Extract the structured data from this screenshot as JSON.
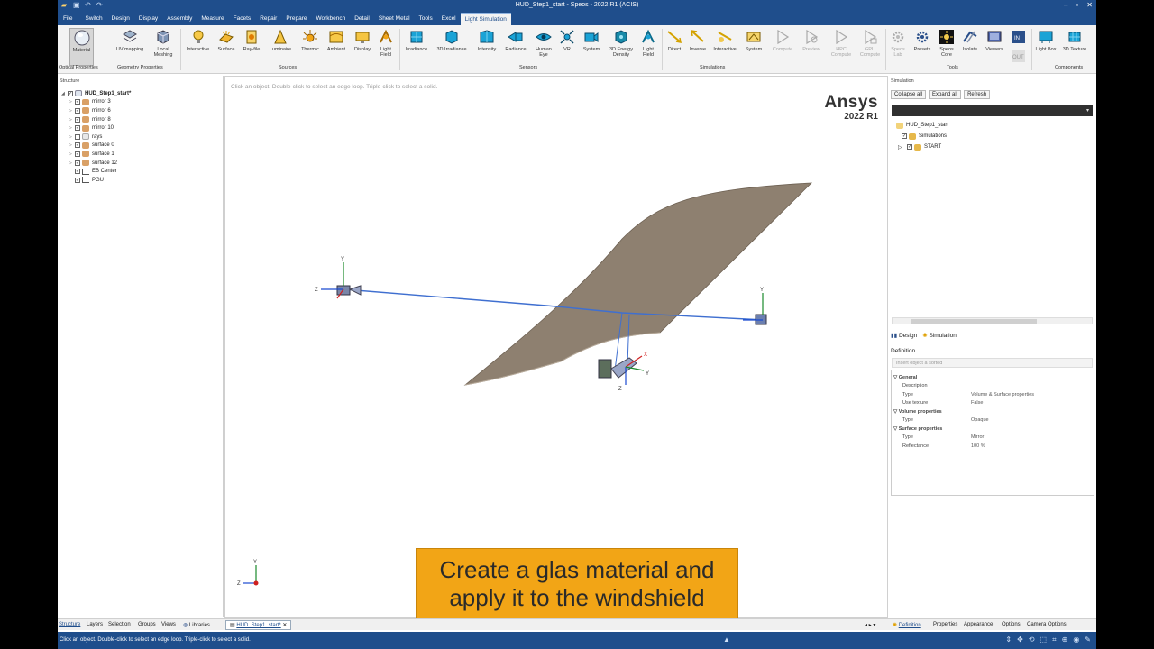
{
  "window": {
    "title": "HUD_Step1_start - Speos - 2022 R1 (ACIS)",
    "controls": [
      "–",
      "▫",
      "✕"
    ]
  },
  "menu_tabs": [
    "File",
    "Switch",
    "Design",
    "Display",
    "Assembly",
    "Measure",
    "Facets",
    "Repair",
    "Prepare",
    "Workbench",
    "Detail",
    "Sheet Metal",
    "Tools",
    "Excel",
    "Light Simulation"
  ],
  "active_tab": "Light Simulation",
  "ribbon": {
    "optical": {
      "group": "Optical Properties",
      "buttons": [
        "Material"
      ]
    },
    "geometry": {
      "group": "Geometry Properties",
      "buttons": [
        "UV mapping",
        "Local Meshing"
      ]
    },
    "sources": {
      "group": "Sources",
      "buttons": [
        "Interactive",
        "Surface",
        "Ray-file",
        "Luminaire",
        "Thermic",
        "Ambient",
        "Display",
        "Light Field"
      ]
    },
    "sensors": {
      "group": "Sensors",
      "buttons": [
        "Irradiance",
        "3D Irradiance",
        "Intensity",
        "Radiance",
        "Human Eye",
        "VR",
        "System",
        "3D Energy Density",
        "Light Field"
      ]
    },
    "simulations": {
      "group": "Simulations",
      "buttons": [
        "Direct",
        "Inverse",
        "Interactive",
        "System",
        "Compute",
        "Preview",
        "HPC Compute",
        "GPU Compute"
      ]
    },
    "tools": {
      "group": "Tools",
      "buttons": [
        "Speos Lab",
        "Presets",
        "Speos Core",
        "Isolate",
        "Viewers",
        "IN",
        "OUT"
      ]
    },
    "components": {
      "group": "Components",
      "buttons": [
        "Light Box",
        "3D Texture"
      ]
    }
  },
  "structure": {
    "header": "Structure",
    "root": "HUD_Step1_start*",
    "items": [
      "mirror 3",
      "mirror 6",
      "mirror 8",
      "mirror 10",
      "rays",
      "surface 0",
      "surface 1",
      "surface 12",
      "EB Center",
      "PGU"
    ]
  },
  "viewport": {
    "hint": "Click an object. Double-click to select an edge loop. Triple-click to select a solid.",
    "brand_name": "Ansys",
    "brand_version": "2022 R1",
    "axis_labels": {
      "x": "X",
      "y": "Y",
      "z": "Z"
    },
    "caption_line1": "Create a glas material and",
    "caption_line2": "apply it to the windshield"
  },
  "simulation_panel": {
    "header": "Simulation",
    "buttons": [
      "Collapse all",
      "Expand all",
      "Refresh"
    ],
    "tree": [
      "HUD_Step1_start",
      "Simulations",
      "START"
    ],
    "tabs": [
      "Design",
      "Simulation"
    ]
  },
  "definition": {
    "header": "Definition",
    "placeholder": "Insert object a sorted",
    "sections": [
      {
        "title": "General",
        "rows": [
          [
            "Description",
            ""
          ],
          [
            "Type",
            "Volume & Surface properties"
          ],
          [
            "Use texture",
            "False"
          ]
        ]
      },
      {
        "title": "Volume properties",
        "rows": [
          [
            "Type",
            "Opaque"
          ]
        ]
      },
      {
        "title": "Surface properties",
        "rows": [
          [
            "Type",
            "Mirror"
          ],
          [
            "Reflectance",
            "100 %"
          ]
        ]
      }
    ]
  },
  "bottom_left_tabs": [
    "Structure",
    "Layers",
    "Selection",
    "Groups",
    "Views",
    "Libraries"
  ],
  "document_tab": "HUD_Step1_start*",
  "bottom_right_tabs": [
    "Definition",
    "Properties",
    "Appearance",
    "Options",
    "Camera Options"
  ],
  "status": {
    "message": "Click an object. Double-click to select an edge loop. Triple-click to select a solid."
  }
}
